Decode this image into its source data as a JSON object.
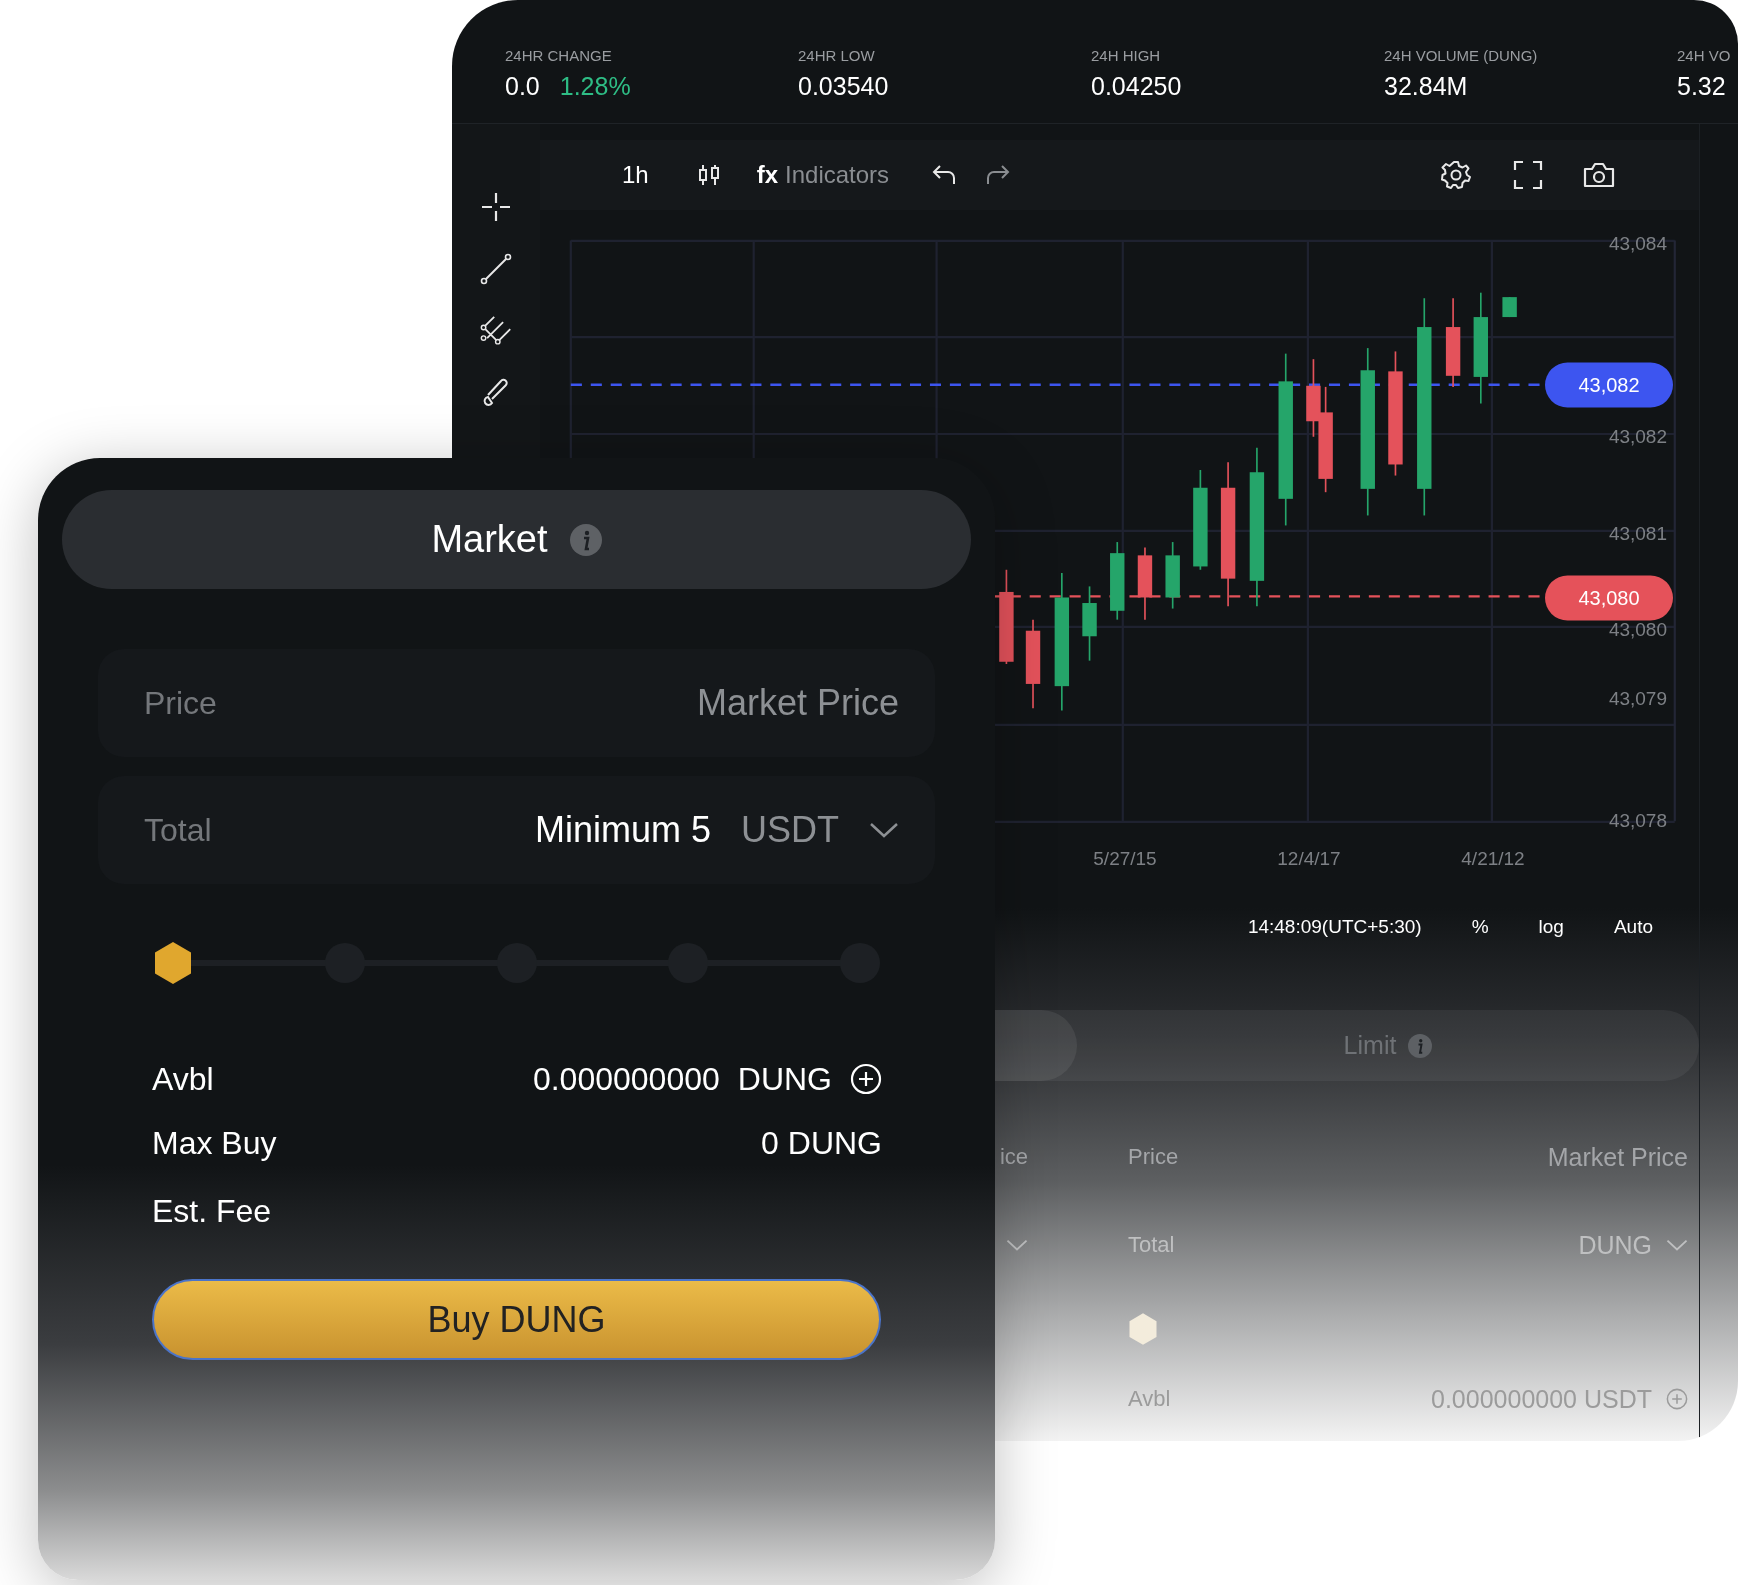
{
  "stats": [
    {
      "label": "24HR CHANGE",
      "value": "0.0",
      "change": "1.28%"
    },
    {
      "label": "24HR LOW",
      "value": "0.03540"
    },
    {
      "label": "24H HIGH",
      "value": "0.04250"
    },
    {
      "label": "24H VOLUME (DUNG)",
      "value": "32.84M"
    },
    {
      "label": "24H VO",
      "value": "5.32"
    }
  ],
  "chart_toolbar": {
    "interval": "1h",
    "indicators_prefix": "fx",
    "indicators": "Indicators"
  },
  "chart": {
    "y_labels": [
      "43,084",
      "43,082",
      "43,081",
      "43,080",
      "43,079",
      "43,078"
    ],
    "x_labels": [
      "5/27/15",
      "12/4/17",
      "4/21/12"
    ],
    "price_lines": [
      {
        "value": "43,082",
        "color": "#3d55f0"
      },
      {
        "value": "43,080",
        "color": "#e5525a"
      }
    ]
  },
  "chart_footer": [
    "14:48:09(UTC+5:30)",
    "%",
    "log",
    "Auto"
  ],
  "order_panel": {
    "tab": {
      "label": "Limit",
      "selected": false
    },
    "partial_value": "ice",
    "price_label": "Price",
    "price_value": "Market Price",
    "total_label": "Total",
    "total_unit": "DUNG",
    "avbl_label": "Avbl",
    "avbl_value": "0.000000000 USDT"
  },
  "market_card": {
    "tab": {
      "label": "Market",
      "selected": true
    },
    "price_label": "Price",
    "price_value": "Market Price",
    "total_label": "Total",
    "total_value": "Minimum 5",
    "total_unit": "USDT",
    "slider": {
      "level": 0
    },
    "rows": [
      {
        "label": "Avbl",
        "value": "0.000000000",
        "unit": "DUNG",
        "kind": "add"
      },
      {
        "label": "Max Buy",
        "value": "0 DUNG",
        "kind": "plain"
      },
      {
        "label": "Est. Fee",
        "kind": "plain"
      }
    ],
    "button": "Buy DUNG"
  }
}
